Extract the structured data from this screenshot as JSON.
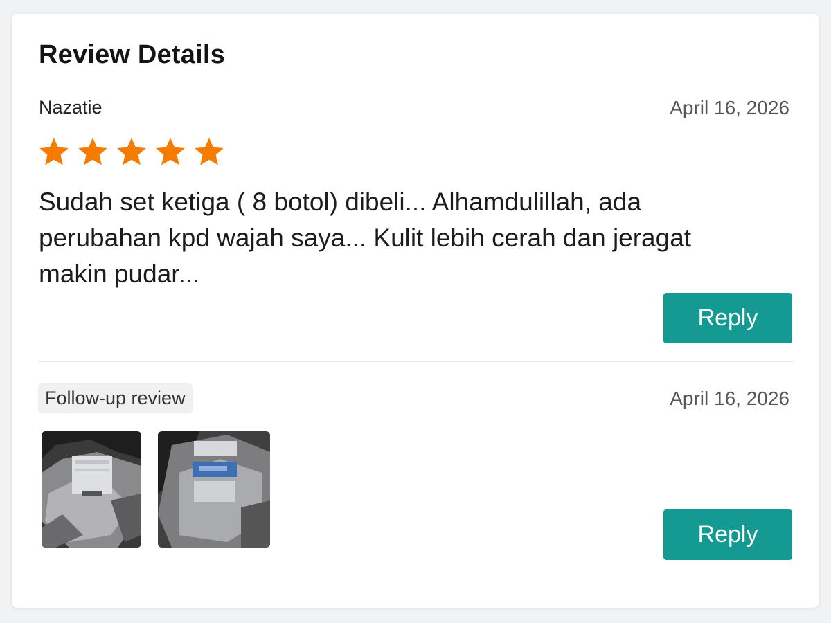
{
  "header": {
    "title": "Review Details"
  },
  "review": {
    "reviewer": "Nazatie",
    "date": "April 16, 2026",
    "rating": 5,
    "rating_max": 5,
    "star_color": "#f57c00",
    "text": "Sudah set ketiga ( 8 botol) dibeli... Alhamdulillah, ada perubahan kpd wajah saya... Kulit lebih cerah dan jeragat makin pudar...",
    "reply_label": "Reply"
  },
  "followup": {
    "badge": "Follow-up review",
    "date": "April 16, 2026",
    "photos": [
      "photo-1",
      "photo-2"
    ],
    "reply_label": "Reply"
  },
  "theme": {
    "accent": "#149a92"
  }
}
